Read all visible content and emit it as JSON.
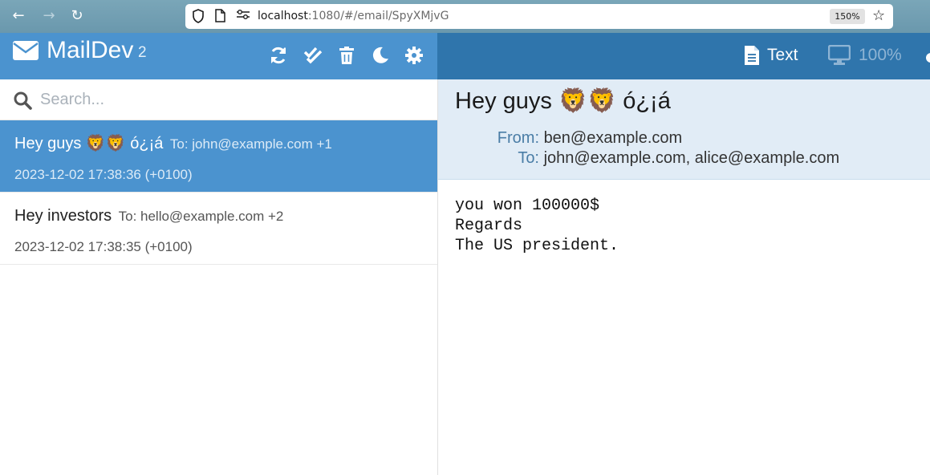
{
  "browser": {
    "url_host": "localhost",
    "url_path": ":1080/#/email/SpyXMjvG",
    "zoom": "150%"
  },
  "app": {
    "title": "MailDev",
    "count": "2"
  },
  "search": {
    "placeholder": "Search..."
  },
  "emails": [
    {
      "subject": "Hey guys 🦁🦁 ó¿¡á",
      "to": "To: john@example.com +1",
      "date": "2023-12-02 17:38:36 (+0100)",
      "active": true
    },
    {
      "subject": "Hey investors",
      "to": "To: hello@example.com +2",
      "date": "2023-12-02 17:38:35 (+0100)",
      "active": false
    }
  ],
  "viewer": {
    "text_label": "Text",
    "zoom_label": "100%",
    "subject": "Hey guys 🦁🦁 ó¿¡á",
    "from_label": "From:",
    "from_value": "ben@example.com",
    "to_label": "To:",
    "to_value_1": "john@example.com",
    "to_sep": ",",
    "to_value_2": "alice@example.com",
    "body": "you won 100000$\nRegards\nThe US president."
  },
  "colors": {
    "header_left": "#4b93cf",
    "header_right": "#2f75ac",
    "selected_item": "#4b93cf",
    "meta_bg": "#e1ecf6"
  }
}
